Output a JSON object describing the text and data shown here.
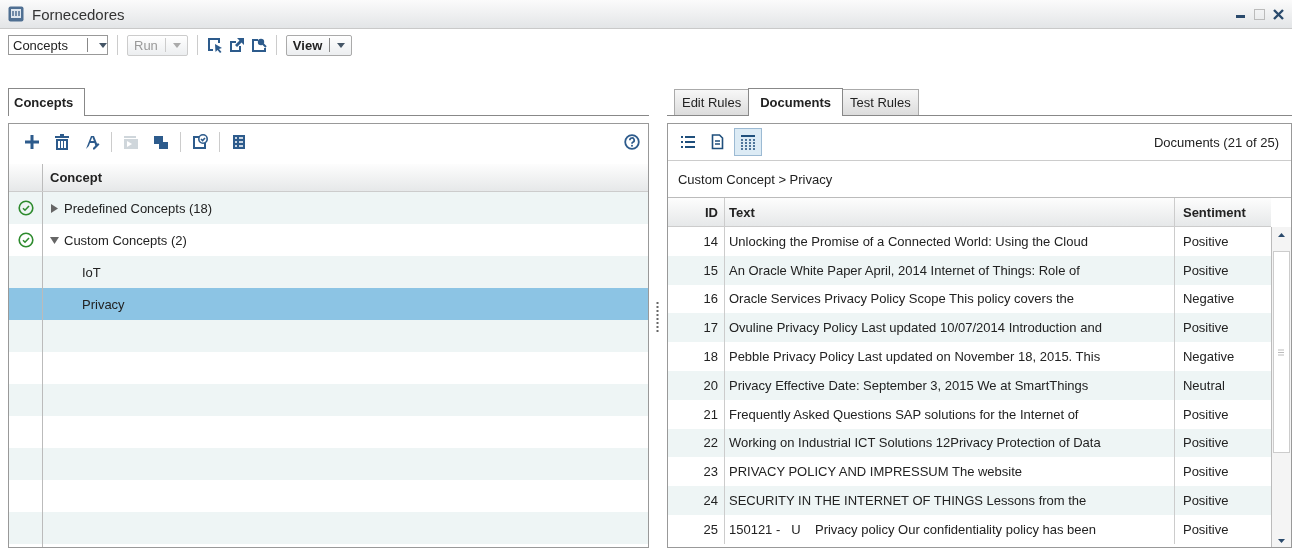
{
  "window": {
    "title": "Fornecedores"
  },
  "toolbar": {
    "dropdown": {
      "value": "Concepts"
    },
    "run_button": {
      "label": "Run",
      "disabled": true
    },
    "view_button": {
      "label": "View"
    }
  },
  "left_panel": {
    "tabs": [
      {
        "label": "Concepts",
        "selected": true
      }
    ],
    "tools": [
      {
        "disabled": false
      },
      {
        "disabled": false
      },
      {
        "disabled": false
      },
      {
        "disabled": true
      },
      {
        "disabled": false
      },
      {
        "disabled": false
      },
      {
        "disabled": false
      }
    ],
    "tree": {
      "column": "Concept",
      "items": [
        {
          "label": "Predefined Concepts (18)",
          "valid": true,
          "expanded": false,
          "selected": false
        },
        {
          "label": "Custom Concepts (2)",
          "valid": true,
          "expanded": true,
          "selected": false,
          "children": [
            {
              "label": "IoT",
              "selected": false
            },
            {
              "label": "Privacy",
              "selected": true
            }
          ]
        }
      ]
    }
  },
  "right_panel": {
    "tabs": [
      {
        "label": "Edit Rules",
        "selected": false
      },
      {
        "label": "Documents",
        "selected": true
      },
      {
        "label": "Test Rules",
        "selected": false
      }
    ],
    "views": [
      {
        "selected": false
      },
      {
        "selected": false
      },
      {
        "selected": true
      }
    ],
    "count": "Documents (21 of 25)",
    "breadcrumb": "Custom Concept > Privacy",
    "table": {
      "columns": [
        "ID",
        "Text",
        "Sentiment"
      ],
      "rows": [
        [
          "14",
          "Unlocking the Promise of a Connected World: Using the Cloud",
          "Positive"
        ],
        [
          "15",
          "An Oracle White Paper April, 2014 Internet of Things: Role of",
          "Positive"
        ],
        [
          "16",
          "Oracle Services Privacy Policy Scope This policy covers the",
          "Negative"
        ],
        [
          "17",
          "Ovuline Privacy Policy Last updated 10/07/2014 Introduction and",
          "Positive"
        ],
        [
          "18",
          "Pebble Privacy Policy Last updated on November 18, 2015. This",
          "Negative"
        ],
        [
          "20",
          "Privacy Effective Date: September 3, 2015 We at SmartThings",
          "Neutral"
        ],
        [
          "21",
          "Frequently Asked Questions SAP solutions for the Internet of",
          "Positive"
        ],
        [
          "22",
          "Working on Industrial ICT Solutions 12Privacy Protection of Data",
          "Positive"
        ],
        [
          "23",
          "PRIVACY POLICY AND IMPRESSUM The website",
          "Positive"
        ],
        [
          "24",
          "SECURITY IN THE INTERNET OF THINGS Lessons from the",
          "Positive"
        ],
        [
          "25",
          "150121 -   U    Privacy policy Our confidentiality policy has been",
          "Positive"
        ]
      ]
    }
  }
}
